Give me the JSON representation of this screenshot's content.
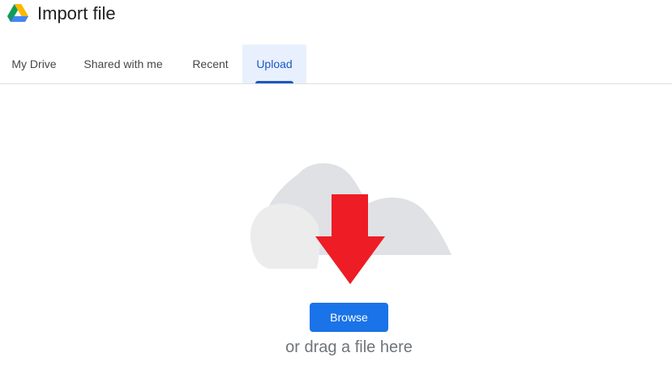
{
  "app": {
    "title": "Import file",
    "logo_icon": "google-drive-icon"
  },
  "tabs": [
    {
      "label": "My Drive",
      "active": false
    },
    {
      "label": "Shared with me",
      "active": false
    },
    {
      "label": "Recent",
      "active": false
    },
    {
      "label": "Upload",
      "active": true
    }
  ],
  "upload": {
    "illustration_icon": "cloud-upload-arrow-icon",
    "browse_label": "Browse",
    "drag_hint": "or drag a file here"
  },
  "colors": {
    "accent": "#1a73e8",
    "active_tab_bg": "#e8f0fe",
    "active_tab_text": "#1a57c6",
    "arrow_red": "#ee1c25",
    "cloud_light": "#ececed",
    "cloud_dark": "#dfe1e5"
  }
}
